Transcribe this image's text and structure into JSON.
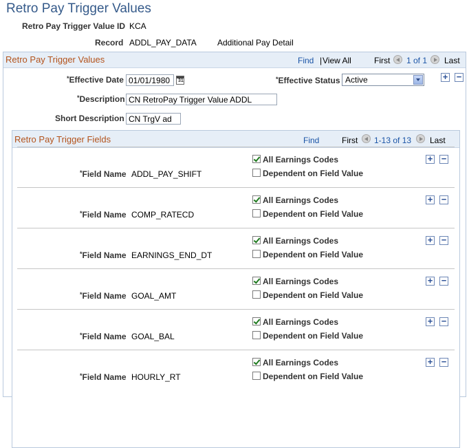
{
  "page": {
    "title": "Retro Pay Trigger Values"
  },
  "header": {
    "id_label": "Retro Pay Trigger Value ID",
    "id_value": "KCA",
    "record_label": "Record",
    "record_value": "ADDL_PAY_DATA",
    "record_desc": "Additional Pay Detail"
  },
  "outer": {
    "title": "Retro Pay Trigger Values",
    "find": "Find",
    "sep": "|",
    "view_all": "View All",
    "first": "First",
    "range": "1 of 1",
    "last": "Last",
    "eff_date_label": "Effective Date",
    "eff_date_value": "01/01/1980",
    "calendar_text": "31",
    "eff_status_label": "Effective Status",
    "eff_status_value": "Active",
    "desc_label": "Description",
    "desc_value": "CN RetroPay Trigger Value ADDL",
    "short_desc_label": "Short Description",
    "short_desc_value": "CN TrgV ad",
    "add": "+",
    "remove": "−",
    "req_mark": "*"
  },
  "fields": {
    "title": "Retro Pay Trigger Fields",
    "find": "Find",
    "first": "First",
    "range": "1-13 of 13",
    "last": "Last",
    "field_name_label": "Field Name",
    "all_codes_label": "All Earnings Codes",
    "dependent_label": "Dependent on Field Value",
    "add": "+",
    "remove": "−",
    "req_mark": "*",
    "rows": [
      {
        "field": "ADDL_PAY_SHIFT",
        "all_codes": true,
        "dependent": false
      },
      {
        "field": "COMP_RATECD",
        "all_codes": true,
        "dependent": false
      },
      {
        "field": "EARNINGS_END_DT",
        "all_codes": true,
        "dependent": false
      },
      {
        "field": "GOAL_AMT",
        "all_codes": true,
        "dependent": false
      },
      {
        "field": "GOAL_BAL",
        "all_codes": true,
        "dependent": false
      },
      {
        "field": "HOURLY_RT",
        "all_codes": true,
        "dependent": false
      }
    ]
  }
}
